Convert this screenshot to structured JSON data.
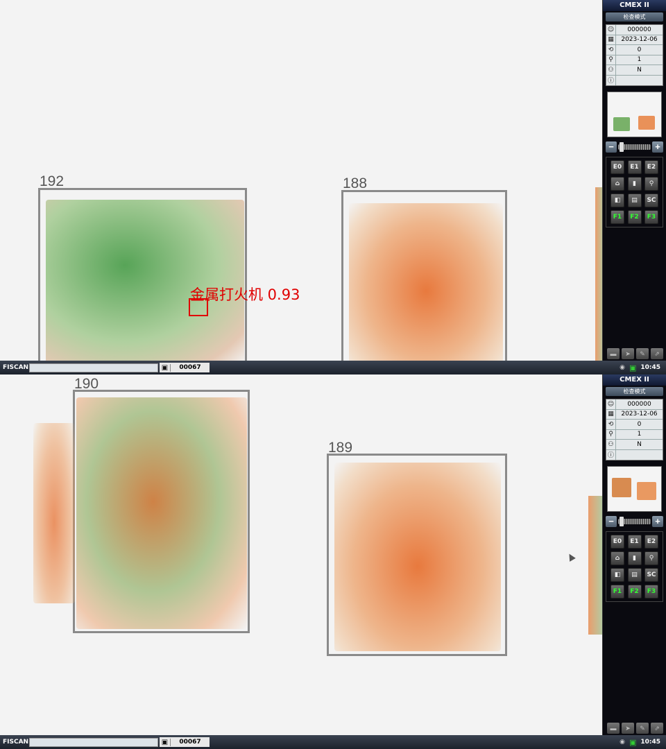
{
  "screens": [
    {
      "panel": {
        "title": "CMEX II",
        "mode": "检查模式",
        "info": [
          {
            "icon": "user-icon",
            "glyph": "☺",
            "value": "000000"
          },
          {
            "icon": "calendar-icon",
            "glyph": "▦",
            "value": "2023-12-06"
          },
          {
            "icon": "count-icon",
            "glyph": "⟲",
            "value": "0"
          },
          {
            "icon": "magnifier-icon",
            "glyph": "⚲",
            "value": "1"
          },
          {
            "icon": "operator-icon",
            "glyph": "⚇",
            "value": "N"
          },
          {
            "icon": "info-icon",
            "glyph": "ⓘ",
            "value": ""
          }
        ],
        "buttons": [
          "E0",
          "E1",
          "E2",
          "⌂",
          "▮",
          "⚲",
          "◧",
          "▤",
          "SC",
          "F1",
          "F2",
          "F3"
        ]
      },
      "bags": [
        {
          "id": "192",
          "color": "green"
        },
        {
          "id": "188",
          "color": "orange"
        }
      ],
      "detection": {
        "label": "金属打火机 0.93",
        "color": "#e00000"
      },
      "statusbar": {
        "brand": "FISCAN",
        "counter": "00067",
        "time": "10:45"
      }
    },
    {
      "panel": {
        "title": "CMEX II",
        "mode": "检查模式",
        "info": [
          {
            "icon": "user-icon",
            "glyph": "☺",
            "value": "000000"
          },
          {
            "icon": "calendar-icon",
            "glyph": "▦",
            "value": "2023-12-06"
          },
          {
            "icon": "count-icon",
            "glyph": "⟲",
            "value": "0"
          },
          {
            "icon": "magnifier-icon",
            "glyph": "⚲",
            "value": "1"
          },
          {
            "icon": "operator-icon",
            "glyph": "⚇",
            "value": "N"
          },
          {
            "icon": "info-icon",
            "glyph": "ⓘ",
            "value": ""
          }
        ],
        "buttons": [
          "E0",
          "E1",
          "E2",
          "⌂",
          "▮",
          "⚲",
          "◧",
          "▤",
          "SC",
          "F1",
          "F2",
          "F3"
        ]
      },
      "bags": [
        {
          "id": "190",
          "color": "mixed"
        },
        {
          "id": "189",
          "color": "orange"
        }
      ],
      "statusbar": {
        "brand": "FISCAN",
        "counter": "00067",
        "time": "10:45"
      }
    }
  ]
}
